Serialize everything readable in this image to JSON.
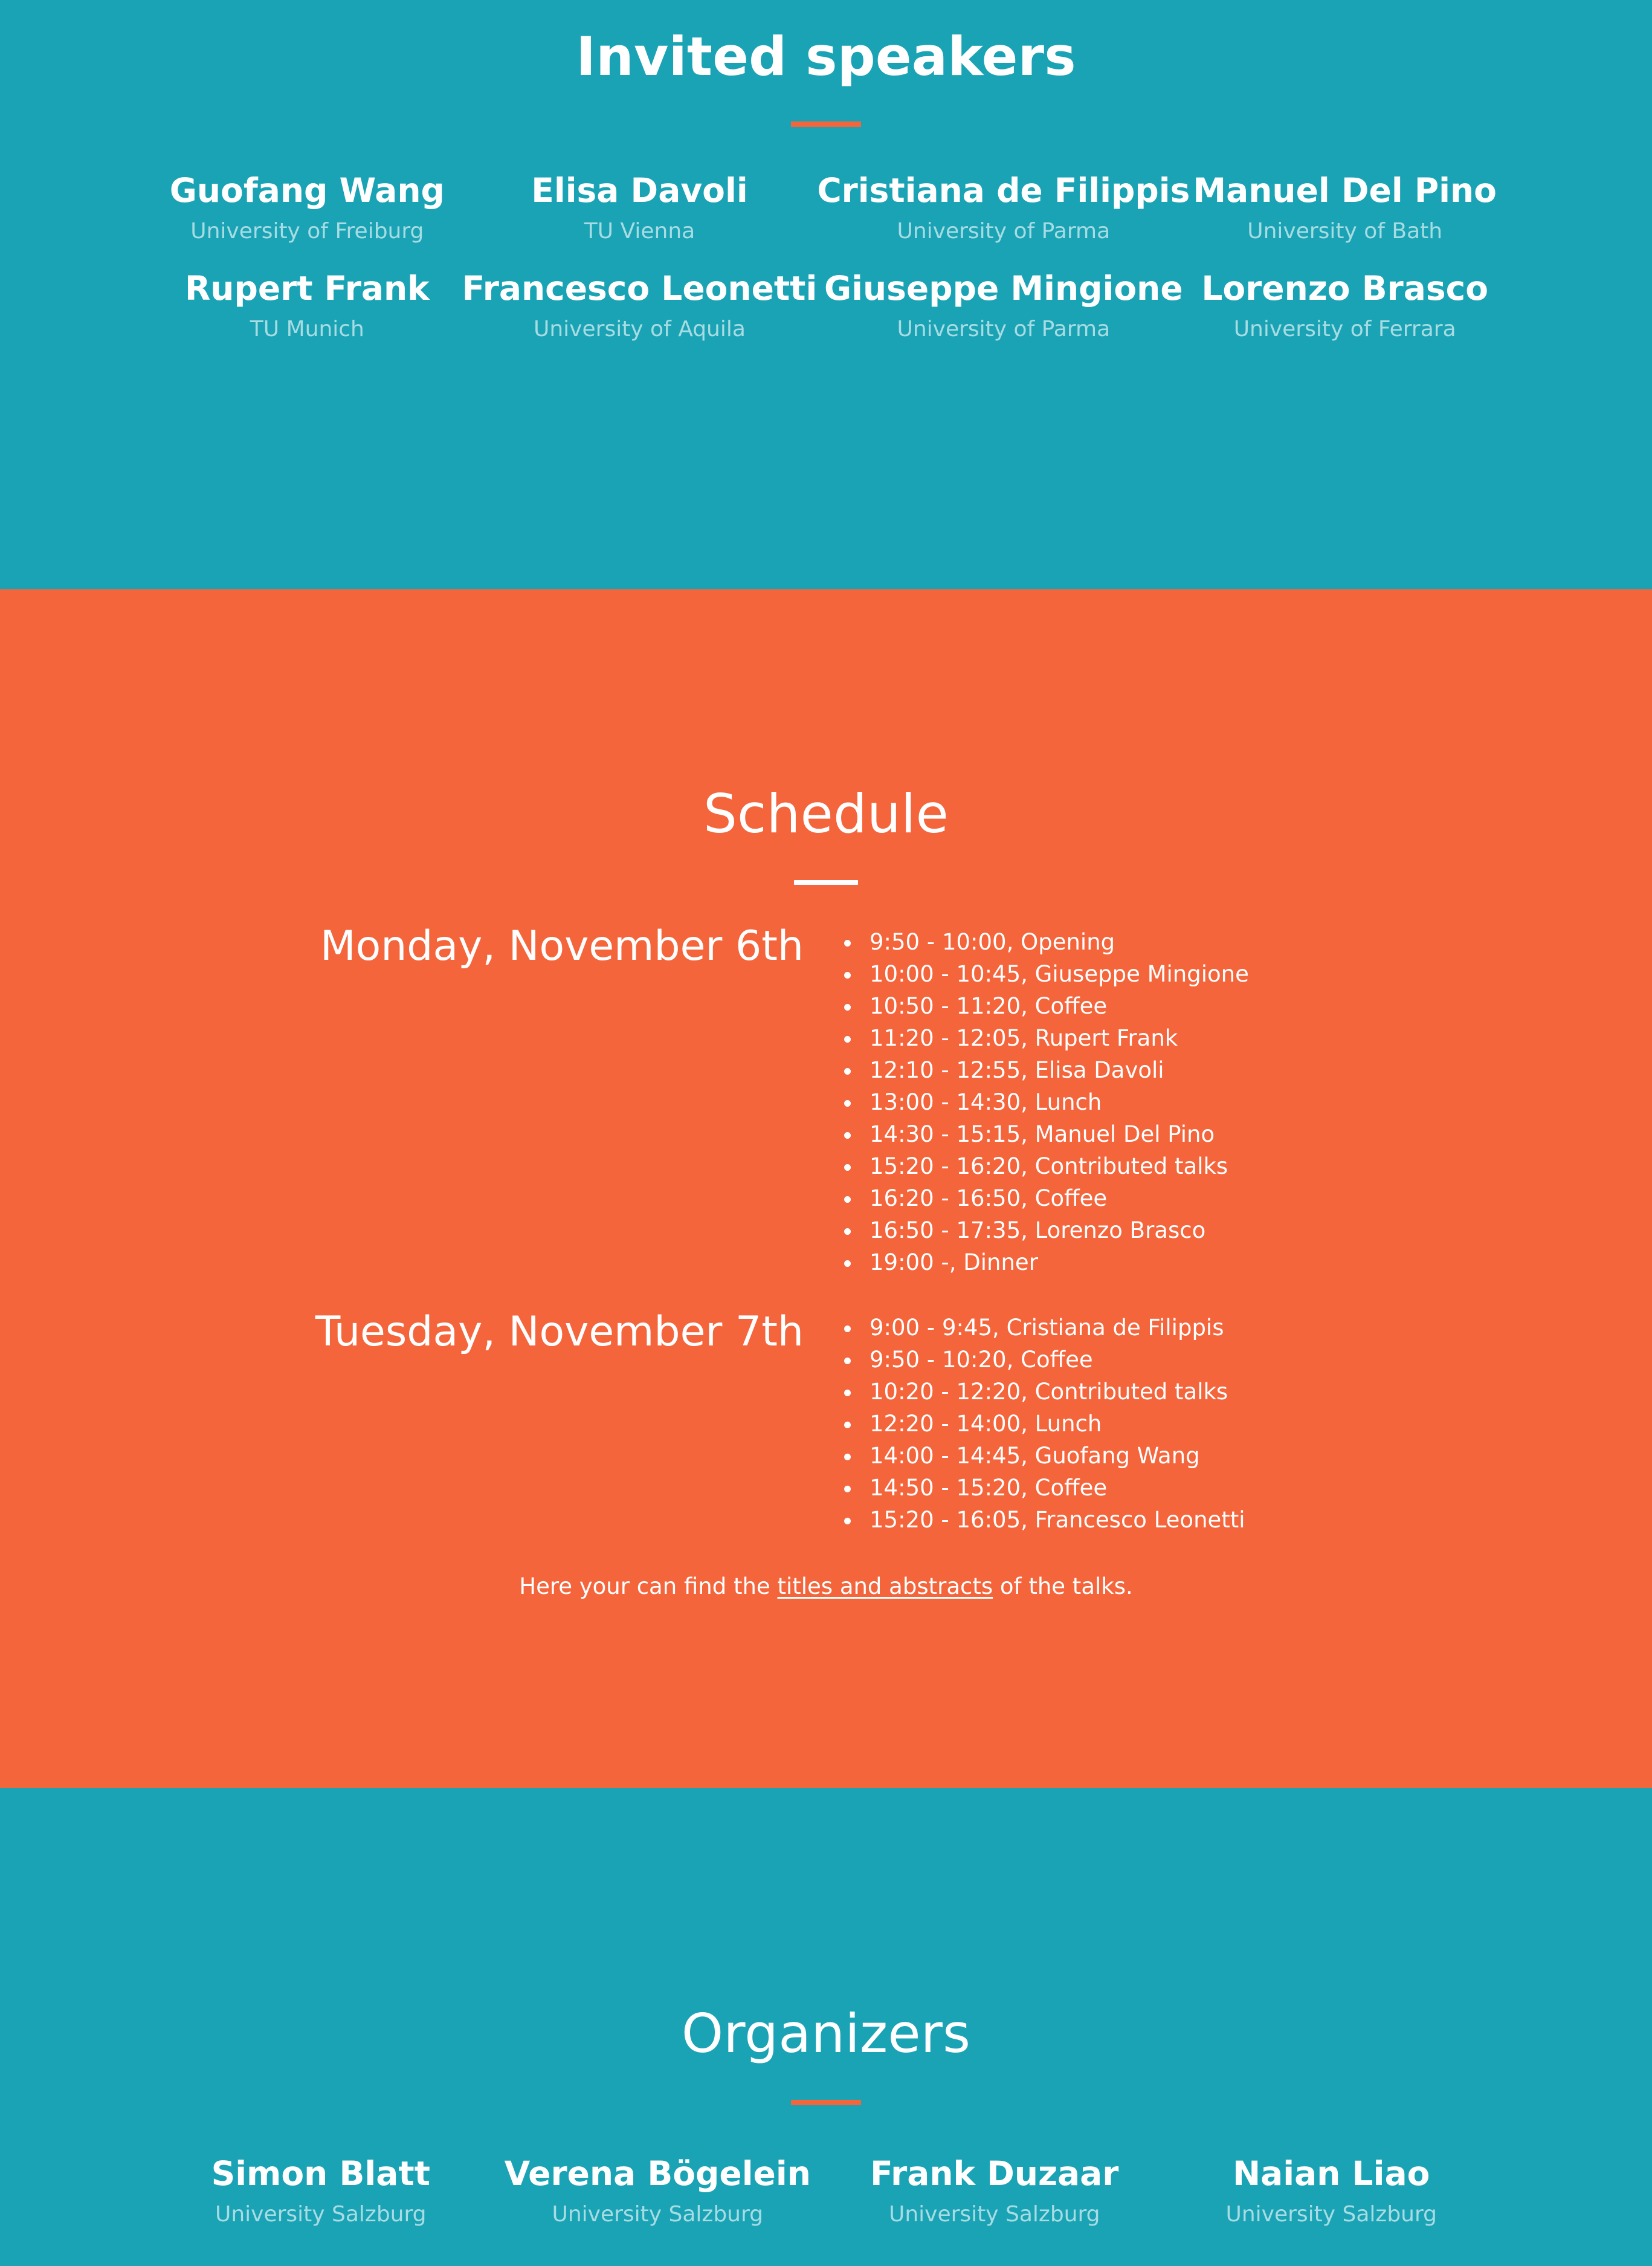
{
  "colors": {
    "teal": "#1AA3B5",
    "orange": "#F4653C",
    "white": "#FFFFFF",
    "affiliation": "rgba(255,255,255,0.62)"
  },
  "speakers_section": {
    "title": "Invited speakers",
    "divider": "orange-rule",
    "people": [
      {
        "name": "Guofang Wang",
        "affiliation": "University of Freiburg"
      },
      {
        "name": "Elisa Davoli",
        "affiliation": "TU Vienna"
      },
      {
        "name": "Cristiana de Filippis",
        "affiliation": "University of Parma"
      },
      {
        "name": "Manuel Del Pino",
        "affiliation": "University of Bath"
      },
      {
        "name": "Rupert Frank",
        "affiliation": "TU Munich"
      },
      {
        "name": "Francesco Leonetti",
        "affiliation": "University of Aquila"
      },
      {
        "name": "Giuseppe Mingione",
        "affiliation": "University of Parma"
      },
      {
        "name": "Lorenzo Brasco",
        "affiliation": "University of Ferrara"
      }
    ]
  },
  "schedule_section": {
    "title": "Schedule",
    "divider": "white-rule",
    "days": [
      {
        "label": "Monday, November 6th",
        "items": [
          "9:50 - 10:00, Opening",
          "10:00 - 10:45, Giuseppe Mingione",
          "10:50 - 11:20, Coffee",
          "11:20 - 12:05, Rupert Frank",
          "12:10 - 12:55, Elisa Davoli",
          "13:00 - 14:30, Lunch",
          "14:30 - 15:15, Manuel Del Pino",
          "15:20 - 16:20, Contributed talks",
          "16:20 - 16:50, Coffee",
          "16:50 - 17:35, Lorenzo Brasco",
          "19:00 -, Dinner"
        ]
      },
      {
        "label": "Tuesday, November 7th",
        "items": [
          "9:00 - 9:45, Cristiana de Filippis",
          "9:50 - 10:20, Coffee",
          "10:20 - 12:20, Contributed talks",
          "12:20 - 14:00, Lunch",
          "14:00 - 14:45, Guofang Wang",
          "14:50 - 15:20, Coffee",
          "15:20 - 16:05, Francesco Leonetti"
        ]
      }
    ],
    "note": {
      "before": "Here your can find the ",
      "link": "titles and abstracts",
      "after": " of the talks."
    }
  },
  "organizers_section": {
    "title": "Organizers",
    "divider": "orange-rule",
    "people": [
      {
        "name": "Simon Blatt",
        "affiliation": "University Salzburg"
      },
      {
        "name": "Verena Bögelein",
        "affiliation": "University Salzburg"
      },
      {
        "name": "Frank Duzaar",
        "affiliation": "University Salzburg"
      },
      {
        "name": "Naian Liao",
        "affiliation": "University Salzburg"
      }
    ]
  }
}
